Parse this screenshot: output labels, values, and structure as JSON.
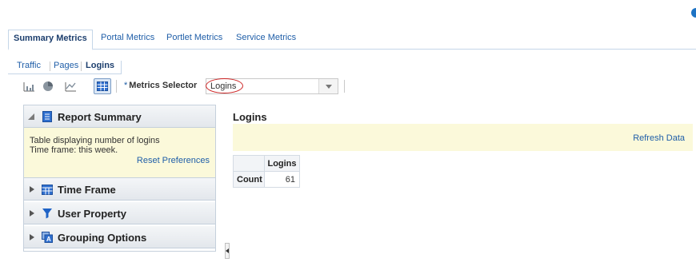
{
  "main_tabs": [
    "Summary Metrics",
    "Portal Metrics",
    "Portlet Metrics",
    "Service Metrics"
  ],
  "sub_tabs": [
    "Traffic",
    "Pages",
    "Logins"
  ],
  "toolbar": {
    "icons": [
      "bar-chart-icon",
      "pie-chart-icon",
      "line-chart-icon",
      "table-icon"
    ],
    "required_marker": "*",
    "metrics_label": "Metrics Selector",
    "metrics_value": "Logins"
  },
  "panel": {
    "report_summary": {
      "title": "Report Summary",
      "line1": "Table displaying number of logins",
      "line2": "Time frame: this week.",
      "reset": "Reset Preferences"
    },
    "time_frame": "Time Frame",
    "user_property": "User Property",
    "grouping_options": "Grouping Options"
  },
  "content": {
    "title": "Logins",
    "refresh": "Refresh Data",
    "table": {
      "column": "Logins",
      "row_label": "Count",
      "value": "61"
    }
  },
  "colors": {
    "link": "#1f5ea8",
    "highlight_band": "#fbf9da",
    "accent_blue": "#1d73c4",
    "selector_ring": "#cc2222"
  }
}
